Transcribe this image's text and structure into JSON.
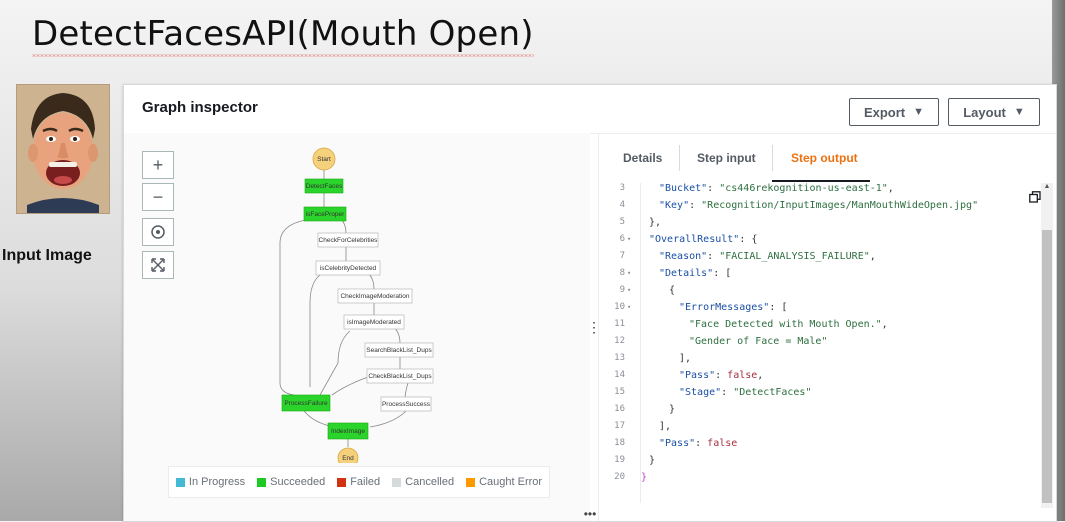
{
  "slide": {
    "title": "DetectFacesAPI(Mouth Open)",
    "input_label": "Input Image"
  },
  "console": {
    "title": "Graph inspector",
    "export_label": "Export",
    "layout_label": "Layout"
  },
  "graph": {
    "nodes": {
      "start": "Start",
      "detect_faces": "DetectFaces",
      "is_face_proper": "isFaceProper",
      "check_for_celebrities": "CheckForCelebrities",
      "is_celebrity_detected": "isCelebrityDetected",
      "check_image_moderation": "CheckImageModeration",
      "is_image_moderated": "isImageModerated",
      "search_blacklist_dups": "SearchBlackList_Dups",
      "check_blacklist_dups": "CheckBlackList_Dups",
      "process_failure": "ProcessFailure",
      "process_success": "ProcessSuccess",
      "index_image": "IndexImage",
      "end": "End"
    },
    "legend": [
      {
        "label": "In Progress",
        "color": "#44b9d6"
      },
      {
        "label": "Succeeded",
        "color": "#1ec924"
      },
      {
        "label": "Failed",
        "color": "#d13212"
      },
      {
        "label": "Cancelled",
        "color": "#d5dbdb"
      },
      {
        "label": "Caught Error",
        "color": "#ff9900"
      }
    ],
    "colors": {
      "succeeded": "#2bd42b",
      "terminal": "#f5d17c"
    }
  },
  "tabs": {
    "details": "Details",
    "step_input": "Step input",
    "step_output": "Step output",
    "active_color": "#ec7211"
  },
  "code": {
    "line_numbers": [
      "3",
      "4",
      "5",
      "6",
      "7",
      "8",
      "9",
      "10",
      "11",
      "12",
      "13",
      "14",
      "15",
      "16",
      "17",
      "18",
      "19",
      "20"
    ],
    "lines": {
      "l3_key": "\"Bucket\"",
      "l3_val": "\"cs446rekognition-us-east-1\"",
      "l4_key": "\"Key\"",
      "l4_val": "\"Recognition/InputImages/ManMouthWideOpen.jpg\"",
      "l5": "},",
      "l6_key": "\"OverallResult\"",
      "l6_rest": ": {",
      "l7_key": "\"Reason\"",
      "l7_val": "\"FACIAL_ANALYSIS_FAILURE\"",
      "l8_key": "\"Details\"",
      "l8_rest": ": [",
      "l9": "{",
      "l10_key": "\"ErrorMessages\"",
      "l10_rest": ": [",
      "l11": "\"Face Detected with Mouth Open.\"",
      "l12": "\"Gender of Face = Male\"",
      "l13": "],",
      "l14_key": "\"Pass\"",
      "l14_val": "false",
      "l15_key": "\"Stage\"",
      "l15_val": "\"DetectFaces\"",
      "l16": "}",
      "l17": "],",
      "l18_key": "\"Pass\"",
      "l18_val": "false",
      "l19": "}",
      "l20": "}"
    }
  }
}
